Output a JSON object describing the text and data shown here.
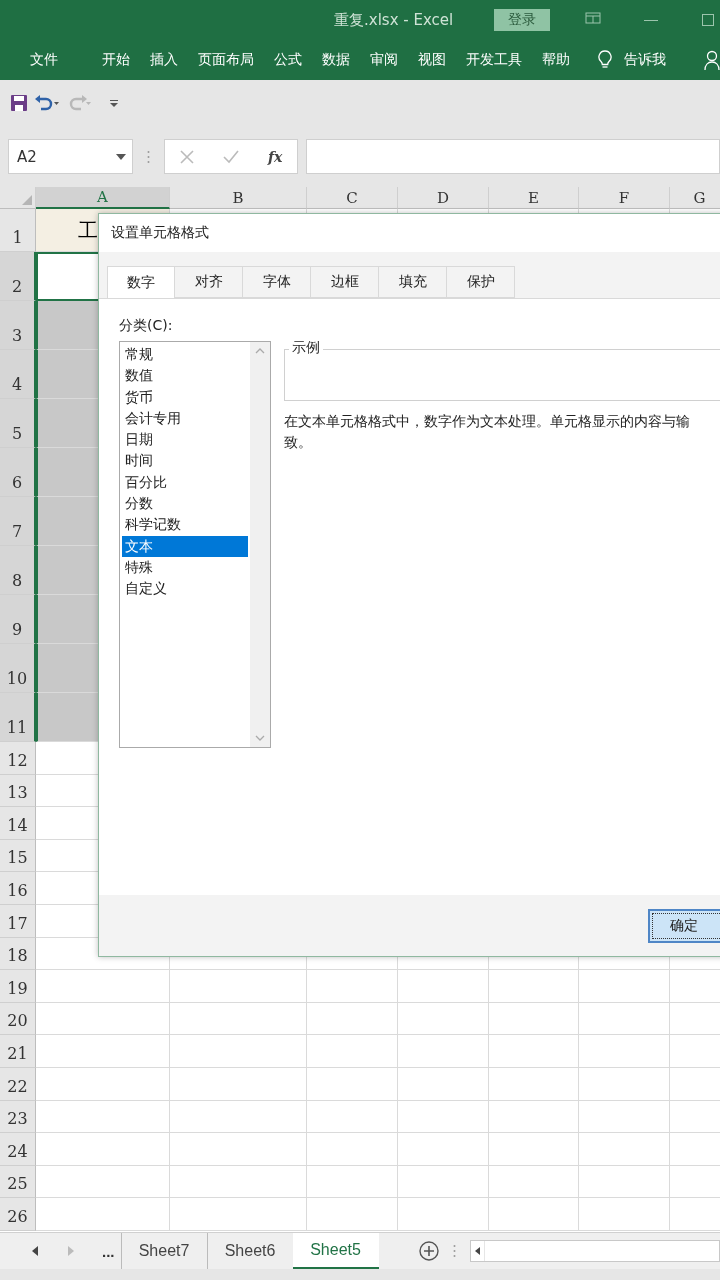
{
  "window": {
    "title": "重复.xlsx  -  Excel",
    "login_button": "登录"
  },
  "ribbon_tabs": [
    "文件",
    "开始",
    "插入",
    "页面布局",
    "公式",
    "数据",
    "审阅",
    "视图",
    "开发工具",
    "帮助"
  ],
  "tell_me": "告诉我",
  "quick_access": {
    "redo_disabled": true
  },
  "formula_bar": {
    "name_box": "A2",
    "function_label": "fx"
  },
  "grid": {
    "columns": [
      {
        "label": "A",
        "selected": true
      },
      {
        "label": "B",
        "selected": false
      },
      {
        "label": "C",
        "selected": false
      },
      {
        "label": "D",
        "selected": false
      },
      {
        "label": "E",
        "selected": false
      },
      {
        "label": "F",
        "selected": false
      },
      {
        "label": "G",
        "selected": false
      }
    ],
    "rows": [
      {
        "label": "1",
        "selected": false,
        "active": false,
        "cells": [
          "工"
        ]
      },
      {
        "label": "2",
        "selected": true,
        "active": true
      },
      {
        "label": "3",
        "selected": true,
        "active": false
      },
      {
        "label": "4",
        "selected": true,
        "active": false
      },
      {
        "label": "5",
        "selected": true,
        "active": false
      },
      {
        "label": "6",
        "selected": true,
        "active": false
      },
      {
        "label": "7",
        "selected": true,
        "active": false
      },
      {
        "label": "8",
        "selected": true,
        "active": false
      },
      {
        "label": "9",
        "selected": true,
        "active": false
      },
      {
        "label": "10",
        "selected": true,
        "active": false
      },
      {
        "label": "11",
        "selected": true,
        "active": false
      },
      {
        "label": "12",
        "selected": false,
        "active": false
      },
      {
        "label": "13",
        "selected": false,
        "active": false
      },
      {
        "label": "14",
        "selected": false,
        "active": false
      },
      {
        "label": "15",
        "selected": false,
        "active": false
      },
      {
        "label": "16",
        "selected": false,
        "active": false
      },
      {
        "label": "17",
        "selected": false,
        "active": false
      },
      {
        "label": "18",
        "selected": false,
        "active": false
      },
      {
        "label": "19",
        "selected": false,
        "active": false
      },
      {
        "label": "20",
        "selected": false,
        "active": false
      },
      {
        "label": "21",
        "selected": false,
        "active": false
      },
      {
        "label": "22",
        "selected": false,
        "active": false
      },
      {
        "label": "23",
        "selected": false,
        "active": false
      },
      {
        "label": "24",
        "selected": false,
        "active": false
      },
      {
        "label": "25",
        "selected": false,
        "active": false
      },
      {
        "label": "26",
        "selected": false,
        "active": false
      }
    ]
  },
  "dialog": {
    "title": "设置单元格格式",
    "tabs": [
      {
        "label": "数字",
        "selected": true
      },
      {
        "label": "对齐",
        "selected": false
      },
      {
        "label": "字体",
        "selected": false
      },
      {
        "label": "边框",
        "selected": false
      },
      {
        "label": "填充",
        "selected": false
      },
      {
        "label": "保护",
        "selected": false
      }
    ],
    "category_label": "分类(C):",
    "categories": [
      {
        "label": "常规",
        "selected": false
      },
      {
        "label": "数值",
        "selected": false
      },
      {
        "label": "货币",
        "selected": false
      },
      {
        "label": "会计专用",
        "selected": false
      },
      {
        "label": "日期",
        "selected": false
      },
      {
        "label": "时间",
        "selected": false
      },
      {
        "label": "百分比",
        "selected": false
      },
      {
        "label": "分数",
        "selected": false
      },
      {
        "label": "科学记数",
        "selected": false
      },
      {
        "label": "文本",
        "selected": true
      },
      {
        "label": "特殊",
        "selected": false
      },
      {
        "label": "自定义",
        "selected": false
      }
    ],
    "sample_label": "示例",
    "description_lines": [
      "在文本单元格格式中，数字作为文本处理。单元格显示的内容与输",
      "致。"
    ],
    "ok_button": "确定"
  },
  "sheet_tabs": {
    "more": "...",
    "tabs": [
      {
        "label": "Sheet7",
        "selected": false
      },
      {
        "label": "Sheet6",
        "selected": false
      },
      {
        "label": "Sheet5",
        "selected": true
      }
    ]
  }
}
